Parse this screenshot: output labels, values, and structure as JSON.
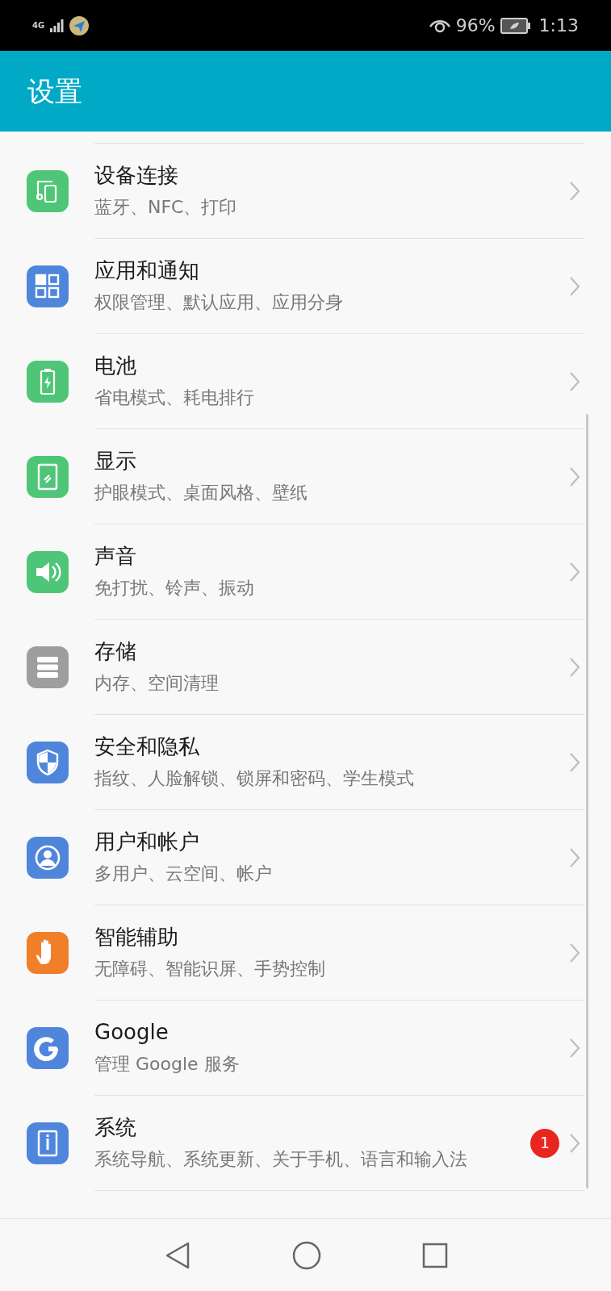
{
  "status_bar": {
    "network": "4G",
    "battery": "96%",
    "time": "1:13"
  },
  "header": {
    "title": "设置"
  },
  "items": [
    {
      "kind": "devices",
      "color": "#4fc677",
      "title": "设备连接",
      "subtitle": "蓝牙、NFC、打印"
    },
    {
      "kind": "apps",
      "color": "#4f86dc",
      "title": "应用和通知",
      "subtitle": "权限管理、默认应用、应用分身"
    },
    {
      "kind": "battery",
      "color": "#4fc677",
      "title": "电池",
      "subtitle": "省电模式、耗电排行"
    },
    {
      "kind": "display",
      "color": "#4fc677",
      "title": "显示",
      "subtitle": "护眼模式、桌面风格、壁纸"
    },
    {
      "kind": "sound",
      "color": "#4fc677",
      "title": "声音",
      "subtitle": "免打扰、铃声、振动"
    },
    {
      "kind": "storage",
      "color": "#9e9e9e",
      "title": "存储",
      "subtitle": "内存、空间清理"
    },
    {
      "kind": "security",
      "color": "#4f86dc",
      "title": "安全和隐私",
      "subtitle": "指纹、人脸解锁、锁屏和密码、学生模式"
    },
    {
      "kind": "users",
      "color": "#4f86dc",
      "title": "用户和帐户",
      "subtitle": "多用户、云空间、帐户"
    },
    {
      "kind": "assist",
      "color": "#f07f2a",
      "title": "智能辅助",
      "subtitle": "无障碍、智能识屏、手势控制"
    },
    {
      "kind": "google",
      "color": "#4f86dc",
      "title": "Google",
      "subtitle": "管理 Google 服务"
    },
    {
      "kind": "system",
      "color": "#4f86dc",
      "title": "系统",
      "subtitle": "系统导航、系统更新、关于手机、语言和输入法",
      "badge": "1"
    }
  ]
}
